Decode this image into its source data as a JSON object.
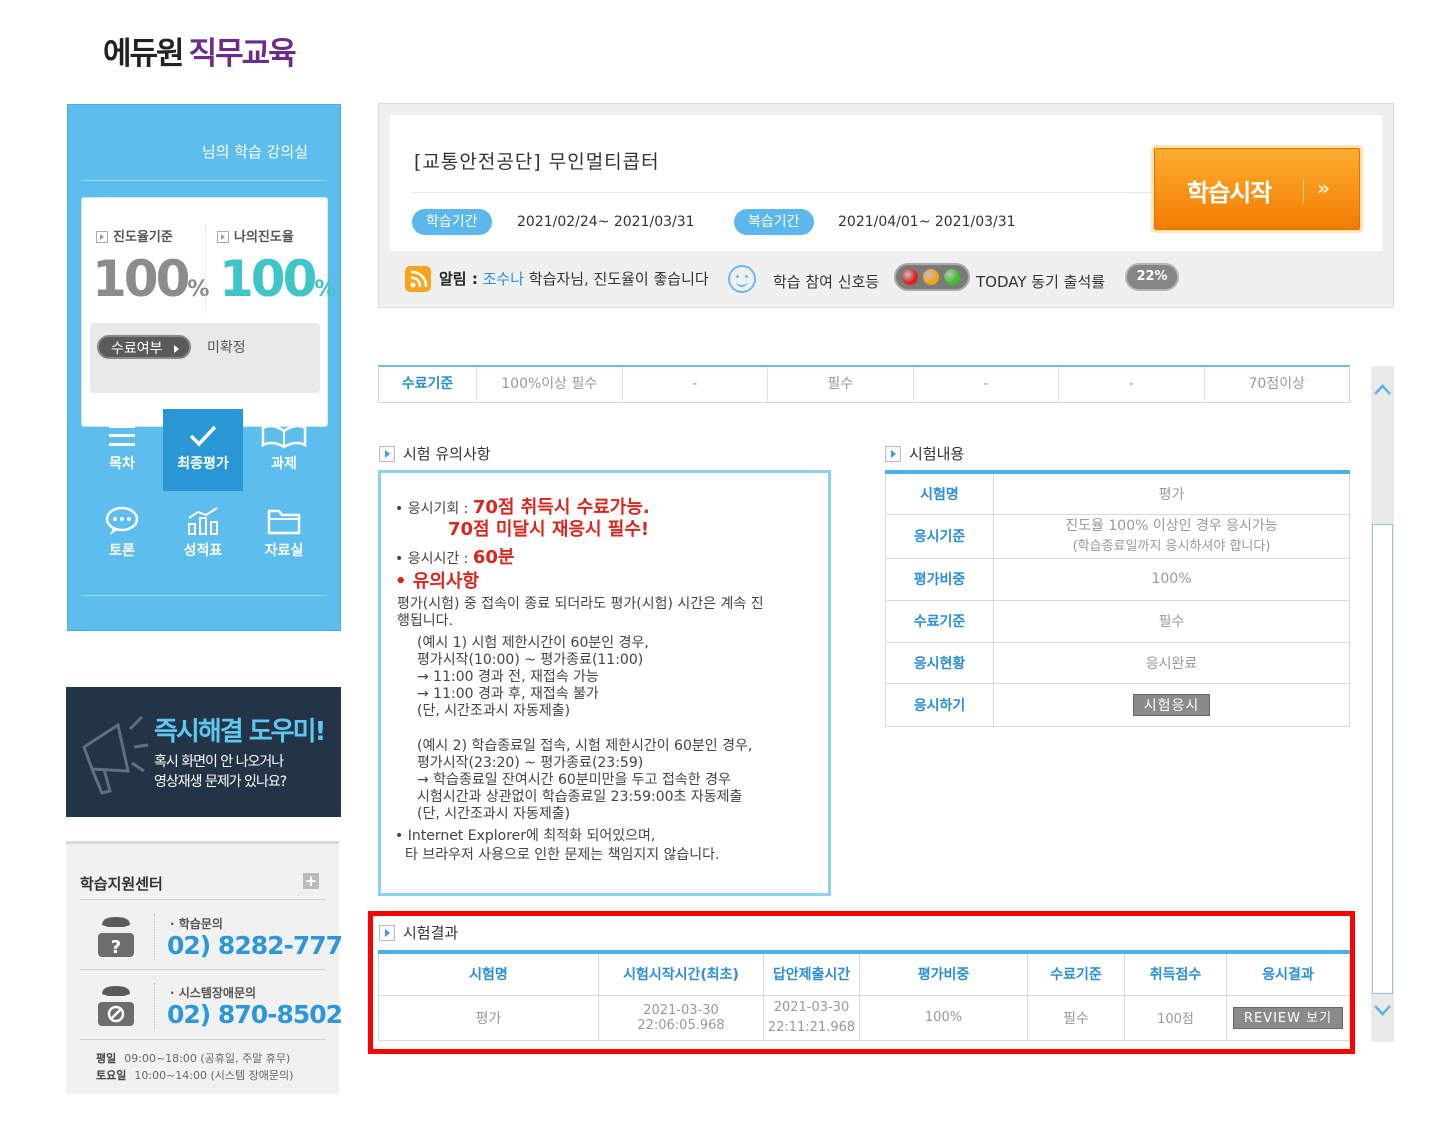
{
  "logo": {
    "part1": "에듀원",
    "part2": "직무교육"
  },
  "left_panel": {
    "title": "님의 학습 강의실",
    "stat_criteria_label": "진도율기준",
    "stat_criteria_value": "100",
    "stat_my_label": "나의진도율",
    "stat_my_value": "100",
    "percent": "%",
    "complete_label": "수료여부",
    "complete_value": "미확정",
    "menu": [
      {
        "label": "목차",
        "icon": "list-icon"
      },
      {
        "label": "최종평가",
        "icon": "check-icon"
      },
      {
        "label": "과제",
        "icon": "book-icon"
      },
      {
        "label": "토론",
        "icon": "chat-icon"
      },
      {
        "label": "성적표",
        "icon": "chart-icon"
      },
      {
        "label": "자료실",
        "icon": "folder-icon"
      }
    ]
  },
  "banner": {
    "title": "즉시해결 도우미!",
    "line1": "혹시 화면이 안 나오거나",
    "line2": "영상재생 문제가 있나요?"
  },
  "support": {
    "title": "학습지원센터",
    "plus": "+",
    "study_label": "학습문의",
    "study_phone": "02) 8282-777",
    "system_label": "시스템장애문의",
    "system_phone": "02) 870-8502",
    "hours": [
      {
        "day": "평일",
        "time": "09:00~18:00 (공휴일, 주말 휴무)"
      },
      {
        "day": "토요일",
        "time": "10:00~14:00 (시스템 장애문의)"
      }
    ]
  },
  "course": {
    "title": "[교통안전공단] 무인멀티콥터",
    "study_period_label": "학습기간",
    "study_period": "2021/02/24~ 2021/03/31",
    "review_period_label": "복습기간",
    "review_period": "2021/04/01~ 2021/03/31",
    "start_button": "학습시작",
    "start_arrow": "»",
    "notice_label": "알림 :",
    "notice_user": "조수나",
    "notice_text": "학습자님, 진도율이 좋습니다",
    "signal_label": "학습 참여 신호등",
    "today_label": "TODAY 동기 출석률",
    "today_rate": "22%",
    "signal_colors": [
      "#e02020",
      "#f2a21a",
      "#3fbf2a"
    ]
  },
  "criteria_row": [
    "수료기준",
    "100%이상 필수",
    "-",
    "필수",
    "-",
    "-",
    "70점이상"
  ],
  "exam_notice": {
    "heading": "시험 유의사항",
    "l1_label": "• 응시기회 : ",
    "l1_red": "70점 취득시 수료가능.",
    "l1_red2": "70점 미달시 재응시 필수!",
    "l2_label": "• 응시시간 : ",
    "l2_red": "60분",
    "caution": "• 유의사항",
    "p1": "평가(시험) 중 접속이 종료 되더라도 평가(시험) 시간은 계속 진",
    "p1b": "행됩니다.",
    "ex1": [
      "(예시 1) 시험 제한시간이 60분인 경우,",
      "평가시작(10:00) ~ 평가종료(11:00)",
      "→ 11:00 경과 전, 재접속 가능",
      "→ 11:00 경과 후, 재접속 불가",
      "(단, 시간조과시 자동제출)"
    ],
    "ex2": [
      "(예시 2) 학습종료일 접속, 시험 제한시간이 60분인 경우,",
      "평가시작(23:20) ~ 평가종료(23:59)",
      "→ 학습종료일 잔여시간 60분미만을 두고 접속한 경우",
      "시험시간과 상관없이 학습종료일 23:59:00초 자동제출",
      "(단, 시간조과시 자동제출)"
    ],
    "ie1": "• Internet Explorer에 최적화 되어있으며,",
    "ie2": "타 브라우저 사용으로 인한 문제는 책임지지 않습니다."
  },
  "exam_content": {
    "heading": "시험내용",
    "rows": [
      {
        "label": "시험명",
        "value": "평가"
      },
      {
        "label": "응시기준",
        "value": "진도율 100% 이상인 경우 응시가능",
        "value2": "(학습종료일까지 응시하셔야 합니다)"
      },
      {
        "label": "평가비중",
        "value": "100%"
      },
      {
        "label": "수료기준",
        "value": "필수"
      },
      {
        "label": "응시현황",
        "value": "응시완료"
      },
      {
        "label": "응시하기",
        "button": "시험응시"
      }
    ]
  },
  "exam_result": {
    "heading": "시험결과",
    "headers": [
      "시험명",
      "시험시작시간(최초)",
      "답안제출시간",
      "평가비중",
      "수료기준",
      "취득점수",
      "응시결과"
    ],
    "row": {
      "name": "평가",
      "start": "2021-03-30 22:06:05.968",
      "submit1": "2021-03-30",
      "submit2": "22:11:21.968",
      "weight": "100%",
      "criteria": "필수",
      "score": "100점",
      "button": "REVIEW 보기"
    }
  }
}
